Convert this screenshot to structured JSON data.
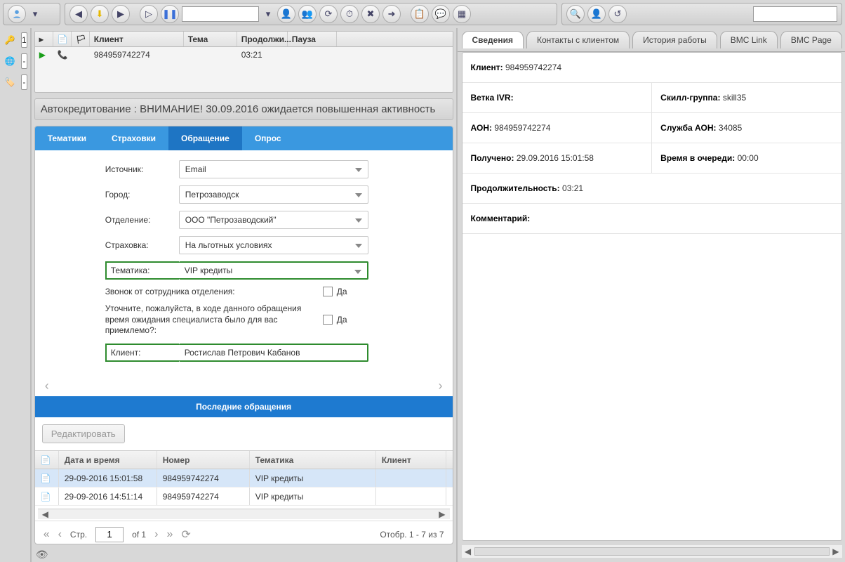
{
  "leftcol": {
    "field1": "1",
    "field2": "-",
    "field3": "-"
  },
  "callgrid": {
    "headers": {
      "client": "Клиент",
      "theme": "Тема",
      "duration": "Продолжи...",
      "pause": "Пауза"
    },
    "row": {
      "client": "984959742274",
      "theme": "",
      "duration": "03:21",
      "pause": ""
    }
  },
  "banner": "Автокредитование : ВНИМАНИЕ! 30.09.2016 ожидается повышенная активность",
  "tabs": {
    "t1": "Тематики",
    "t2": "Страховки",
    "t3": "Обращение",
    "t4": "Опрос"
  },
  "form": {
    "source_label": "Источник:",
    "source": "Email",
    "city_label": "Город:",
    "city": "Петрозаводск",
    "dept_label": "Отделение:",
    "dept": "ООО \"Петрозаводский\"",
    "insurance_label": "Страховка:",
    "insurance": "На льготных условиях",
    "topic_label": "Тематика:",
    "topic": "VIP кредиты",
    "q1": "Звонок от сотрудника отделения:",
    "q2": "Уточните, пожалуйста, в ходе данного обращения время ожидания специалиста было для вас приемлемо?:",
    "yes": "Да",
    "client_label": "Клиент:",
    "client": "Ростислав Петрович Кабанов"
  },
  "section_hist": "Последние обращения",
  "edit_btn": "Редактировать",
  "hist": {
    "headers": {
      "dt": "Дата и время",
      "num": "Номер",
      "topic": "Тематика",
      "client": "Клиент"
    },
    "rows": [
      {
        "dt": "29-09-2016 15:01:58",
        "num": "984959742274",
        "topic": "VIP кредиты",
        "client": ""
      },
      {
        "dt": "29-09-2016 14:51:14",
        "num": "984959742274",
        "topic": "VIP кредиты",
        "client": ""
      }
    ]
  },
  "pager": {
    "page_label": "Стр.",
    "page": "1",
    "of": "of 1",
    "summary": "Отобр. 1 - 7 из 7"
  },
  "rtabs": {
    "t1": "Сведения",
    "t2": "Контакты с клиентом",
    "t3": "История работы",
    "t4": "BMC Link",
    "t5": "BMC Page"
  },
  "info": {
    "client_k": "Клиент:",
    "client_v": "984959742274",
    "ivr_k": "Ветка IVR:",
    "ivr_v": "",
    "skill_k": "Скилл-группа:",
    "skill_v": "skill35",
    "aon_k": "АОН:",
    "aon_v": "984959742274",
    "aonserv_k": "Служба АОН:",
    "aonserv_v": "34085",
    "recv_k": "Получено:",
    "recv_v": "29.09.2016 15:01:58",
    "queue_k": "Время в очереди:",
    "queue_v": "00:00",
    "dur_k": "Продолжительность:",
    "dur_v": "03:21",
    "comment_k": "Комментарий:",
    "comment_v": ""
  }
}
